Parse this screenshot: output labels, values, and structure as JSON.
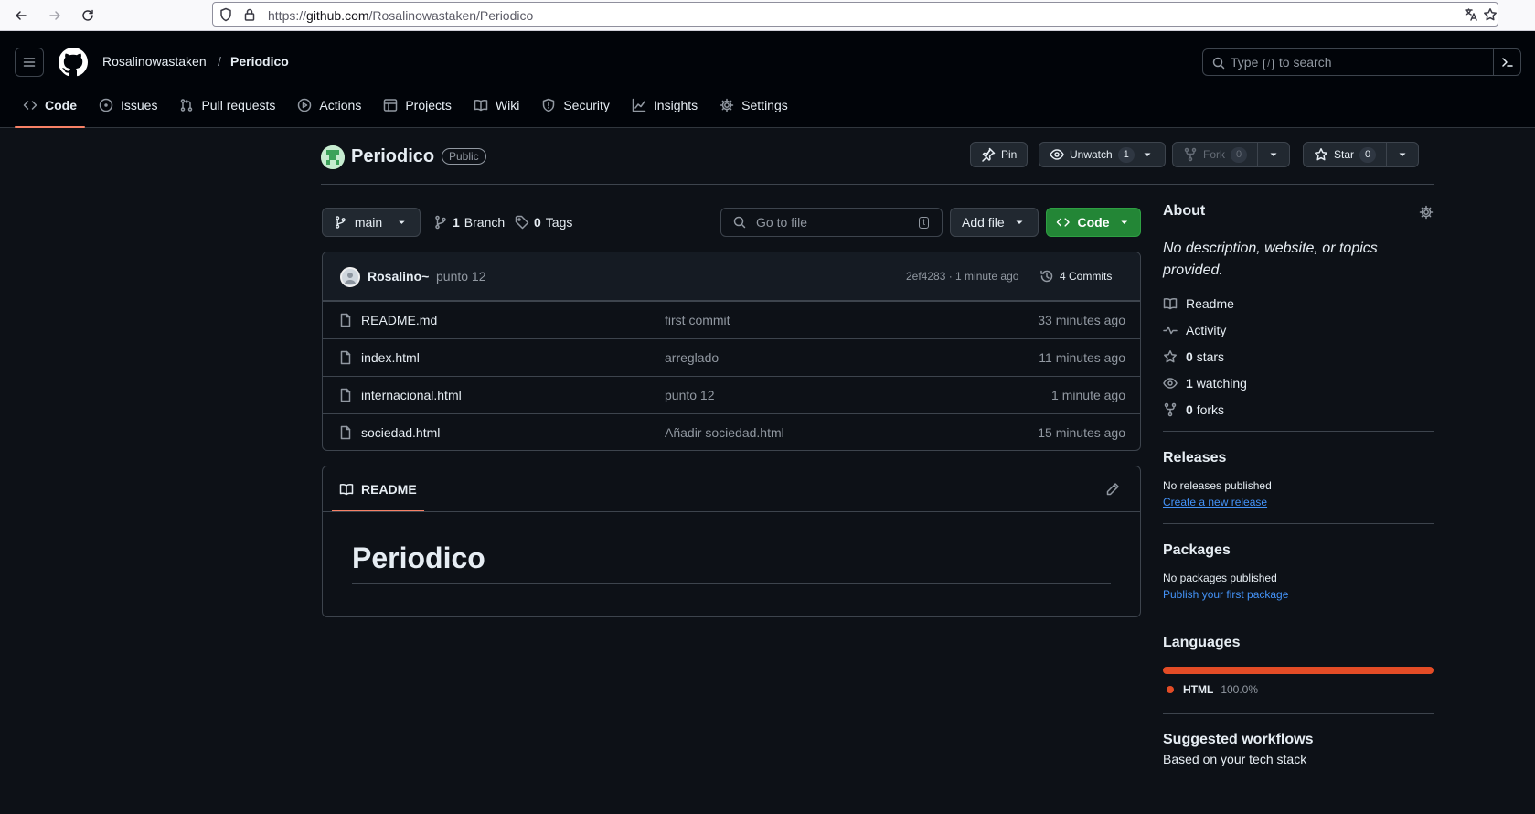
{
  "browser": {
    "url_prefix": "https://",
    "url_domain": "github.com",
    "url_path": "/Rosalinowastaken/Periodico"
  },
  "header": {
    "owner": "Rosalinowastaken",
    "separator": "/",
    "repo": "Periodico",
    "search_prefix": "Type",
    "search_key": "/",
    "search_suffix": "to search"
  },
  "tabs": [
    {
      "label": "Code",
      "icon": "code-icon"
    },
    {
      "label": "Issues",
      "icon": "issue-icon"
    },
    {
      "label": "Pull requests",
      "icon": "pull-request-icon"
    },
    {
      "label": "Actions",
      "icon": "play-icon"
    },
    {
      "label": "Projects",
      "icon": "table-icon"
    },
    {
      "label": "Wiki",
      "icon": "book-icon"
    },
    {
      "label": "Security",
      "icon": "shield-icon"
    },
    {
      "label": "Insights",
      "icon": "graph-icon"
    },
    {
      "label": "Settings",
      "icon": "gear-icon"
    }
  ],
  "repo": {
    "name": "Periodico",
    "visibility": "Public",
    "pin_label": "Pin",
    "unwatch_label": "Unwatch",
    "watch_count": "1",
    "fork_label": "Fork",
    "fork_count": "0",
    "star_label": "Star",
    "star_count": "0"
  },
  "toolbar": {
    "branch": "main",
    "branch_count": "1",
    "branch_label": "Branch",
    "tag_count": "0",
    "tag_label": "Tags",
    "go_to_file": "Go to file",
    "go_to_file_key": "t",
    "add_file": "Add file",
    "code": "Code"
  },
  "commit": {
    "author": "Rosalino~",
    "message": "punto 12",
    "hash_time": "2ef4283 · 1 minute ago",
    "commits_label": "4 Commits"
  },
  "files": [
    {
      "name": "README.md",
      "message": "first commit",
      "time": "33 minutes ago"
    },
    {
      "name": "index.html",
      "message": "arreglado",
      "time": "11 minutes ago"
    },
    {
      "name": "internacional.html",
      "message": "punto 12",
      "time": "1 minute ago"
    },
    {
      "name": "sociedad.html",
      "message": "Añadir sociedad.html",
      "time": "15 minutes ago"
    }
  ],
  "readme": {
    "tab_label": "README",
    "heading": "Periodico"
  },
  "about": {
    "title": "About",
    "description": "No description, website, or topics provided.",
    "readme": "Readme",
    "activity": "Activity",
    "stars_count": "0",
    "stars_label": "stars",
    "watching_count": "1",
    "watching_label": "watching",
    "forks_count": "0",
    "forks_label": "forks"
  },
  "releases": {
    "title": "Releases",
    "empty": "No releases published",
    "link": "Create a new release"
  },
  "packages": {
    "title": "Packages",
    "empty": "No packages published",
    "link": "Publish your first package"
  },
  "languages": {
    "title": "Languages",
    "name": "HTML",
    "percent": "100.0%",
    "share": 1.0,
    "color": "#e34c26"
  },
  "workflows": {
    "title": "Suggested workflows",
    "subtitle": "Based on your tech stack"
  },
  "colors": {
    "page_bg": "#0d1117",
    "header_bg": "#010409",
    "accent_tab": "#f78166",
    "link": "#4493f8",
    "code_button": "#238636"
  }
}
